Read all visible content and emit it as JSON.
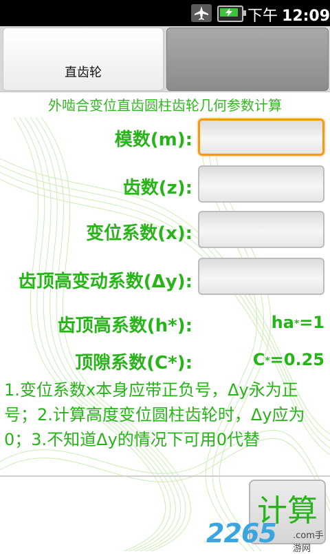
{
  "status_bar": {
    "time_prefix": "下午",
    "time": "12:09"
  },
  "tabs": [
    {
      "label": "直齿轮",
      "active": true
    },
    {
      "label": "",
      "active": false
    }
  ],
  "page_title": "外啮合变位直齿圆柱齿轮几何参数计算",
  "form": {
    "module_label": "模数(m):",
    "module_value": "",
    "teeth_label": "齿数(z):",
    "teeth_value": "",
    "shift_label": "变位系数(x):",
    "shift_value": "",
    "delta_y_label": "齿顶高变动系数(Δy):",
    "delta_y_value": "",
    "ha_label": "齿顶高系数(h*):",
    "ha_value_prefix": "ha",
    "ha_value_star": "*",
    "ha_value_suffix": "=1",
    "c_label": "顶隙系数(C*):",
    "c_value_prefix": "C",
    "c_value_star": "*",
    "c_value_suffix": "=0.25"
  },
  "notes": "1.变位系数x本身应带正负号，Δy永为正号；2.计算高度变位圆柱齿轮时，Δy应为0；3.不知道Δy的情况下可用0代替",
  "calc_button": "计算",
  "watermark": {
    "number": "2265",
    "suffix": ".com",
    "text": "手游网"
  },
  "colors": {
    "accent_green": "#26b418",
    "focus_orange": "#f29a16",
    "watermark_blue": "#3aa5de"
  }
}
